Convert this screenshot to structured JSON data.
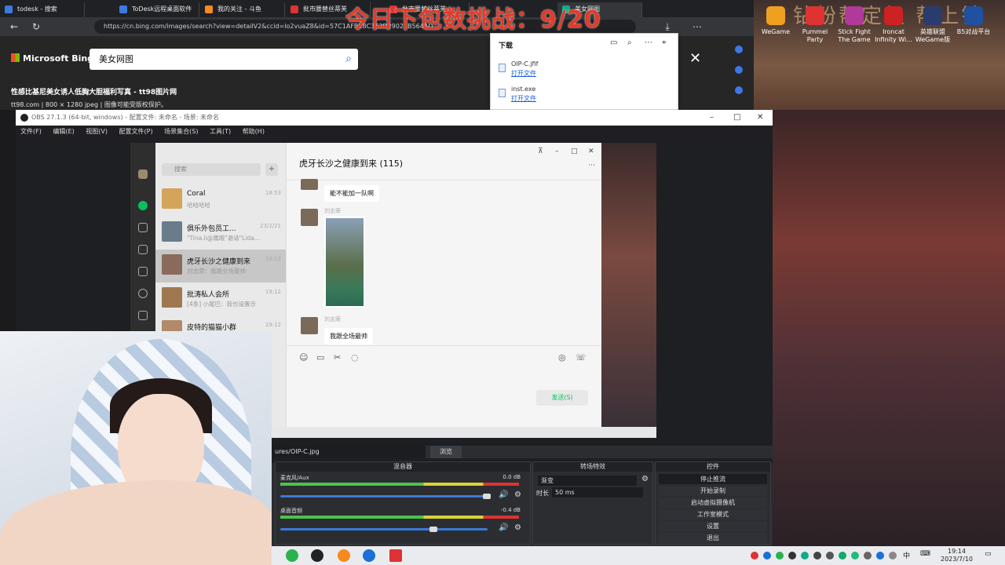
{
  "browser": {
    "tabs": [
      {
        "label": "todesk - 搜索"
      },
      {
        "label": "ToDesk远程桌面软件"
      },
      {
        "label": "我的关注 - 斗鱼"
      },
      {
        "label": "批市腰替丝蒂芙"
      },
      {
        "label": "批市腰替丝蒂芙"
      },
      {
        "label": "美女网图"
      }
    ],
    "url": "https://cn.bing.com/images/search?view=detailV2&ccid=lo2vuaZ8&id=57C1AFBE8C353D29021B564AD"
  },
  "bing": {
    "logo": "Microsoft Bing",
    "query": "美女网图",
    "image_title": "性感比基尼美女诱人低胸大胆福利写真 - tt98图片网",
    "image_meta": "tt98.com  |  800 × 1280 jpeg  |  图像可能受版权保护。"
  },
  "downloads": {
    "title": "下载",
    "items": [
      {
        "name": "OIP-C.jfif",
        "action": "打开文件"
      },
      {
        "name": "inst.exe",
        "action": "打开文件"
      }
    ]
  },
  "overlay": {
    "stream_text": "今日下包数挑战：9/20",
    "stream_text_colors": [
      "#e23b2a"
    ],
    "right_text": "钻粉帮定级 帮上钻"
  },
  "desktop_icons": [
    {
      "label": "WeGame",
      "color": "#f0a020"
    },
    {
      "label": "Pummel Party",
      "color": "#d33"
    },
    {
      "label": "Stick Fight The Game",
      "color": "#b03a9a"
    },
    {
      "label": "Ironcat Infinity Wi...",
      "color": "#c22"
    },
    {
      "label": "英雄联盟WeGame版",
      "color": "#2a3c6e"
    },
    {
      "label": "B5对战平台",
      "color": "#2050a0"
    }
  ],
  "obs": {
    "title": "OBS 27.1.3 (64-bit, windows) - 配置文件: 未命名 - 场景: 未命名",
    "menu": [
      "文件(F)",
      "编辑(E)",
      "视图(V)",
      "配置文件(P)",
      "场景集合(S)",
      "工具(T)",
      "帮助(H)"
    ],
    "scene_file": "ures/OIP-C.jpg",
    "browse": "浏览",
    "mixer": {
      "title": "混音器",
      "channels": [
        {
          "name": "麦克风/Aux",
          "db": "0.0 dB"
        },
        {
          "name": "桌面音频",
          "db": "-0.4 dB"
        }
      ]
    },
    "transitions": {
      "title": "转场特效",
      "type": "渐变",
      "duration_label": "时长",
      "duration": "50 ms"
    },
    "controls": {
      "title": "控件",
      "buttons": [
        "停止推流",
        "开始录制",
        "启动虚拟摄像机",
        "工作室模式",
        "设置",
        "退出"
      ]
    }
  },
  "wechat": {
    "search_placeholder": "搜索",
    "chats": [
      {
        "name": "Coral",
        "preview": "哈哈哈哈",
        "time": "18:53"
      },
      {
        "name": "俱乐外包员工...",
        "preview": "\"Tina.li@鹰眼\"邀请\"Lida...",
        "time": "23/2/21"
      },
      {
        "name": "虎牙长沙之健康到来",
        "preview": "刘志荣：我跟全场最帅",
        "time": "19:13"
      },
      {
        "name": "批涛私人会所",
        "preview": "[4条] 小尾巴：我也设置示",
        "time": "19:12"
      },
      {
        "name": "皮特的猫猫小群",
        "preview": "",
        "time": "19:12"
      }
    ],
    "chat_title": "虎牙长沙之健康到来 (115)",
    "messages": [
      {
        "sender": "",
        "text": "能不能加一队啊"
      },
      {
        "sender": "刘志荣",
        "text": "[图片]"
      },
      {
        "sender": "刘志荣",
        "text": "我跟全场最帅"
      }
    ],
    "send": "发送(S)"
  },
  "taskbar": {
    "time": "19:14",
    "date": "2023/7/10",
    "ime": "中"
  }
}
